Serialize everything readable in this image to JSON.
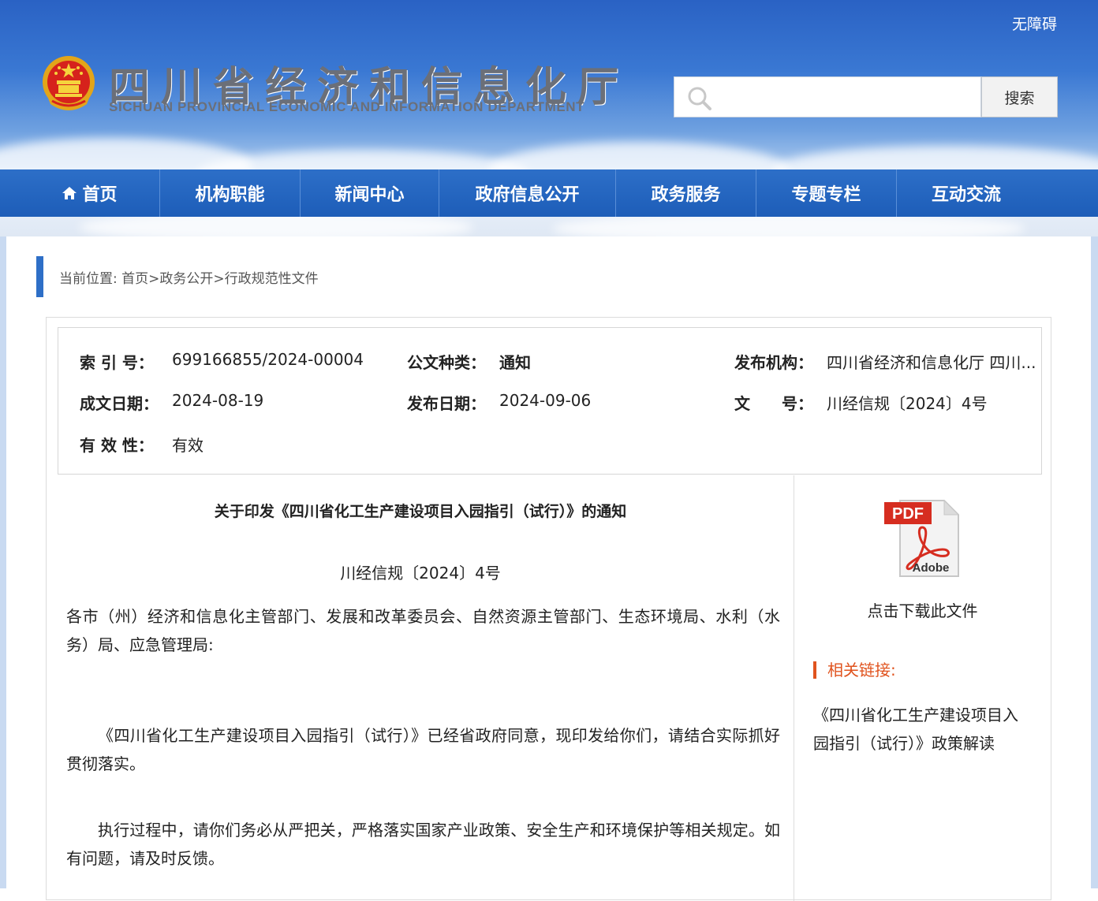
{
  "header": {
    "accessibility_label": "无障碍",
    "title_cn": "四川省经济和信息化厅",
    "title_en": "SICHUAN PROVINCIAL ECONOMIC AND INFORMATION DEPARTMENT",
    "search_placeholder": "",
    "search_button": "搜索"
  },
  "nav": {
    "items": [
      {
        "label": "首页",
        "icon": "home-icon"
      },
      {
        "label": "机构职能"
      },
      {
        "label": "新闻中心"
      },
      {
        "label": "政府信息公开"
      },
      {
        "label": "政务服务"
      },
      {
        "label": "专题专栏"
      },
      {
        "label": "互动交流"
      }
    ]
  },
  "breadcrumb": {
    "text": "当前位置: 首页>政务公开>行政规范性文件"
  },
  "meta": {
    "index_label": "索 引 号：",
    "index_value": "699166855/2024-00004",
    "type_label": "公文种类：",
    "type_value": "通知",
    "org_label": "发布机构：",
    "org_value": "四川省经济和信息化厅 四川...",
    "created_label": "成文日期：",
    "created_value": "2024-08-19",
    "published_label": "发布日期：",
    "published_value": "2024-09-06",
    "docno_label": "文　　号：",
    "docno_value": "川经信规〔2024〕4号",
    "validity_label": "有 效 性：",
    "validity_value": "有效"
  },
  "article": {
    "title": "关于印发《四川省化工生产建设项目入园指引（试行）》的通知",
    "doc_number": "川经信规〔2024〕4号",
    "addressee": "各市（州）经济和信息化主管部门、发展和改革委员会、自然资源主管部门、生态环境局、水利（水务）局、应急管理局:",
    "para1": "《四川省化工生产建设项目入园指引（试行）》已经省政府同意，现印发给你们，请结合实际抓好贯彻落实。",
    "para2": "执行过程中，请你们务必从严把关，严格落实国家产业政策、安全生产和环境保护等相关规定。如有问题，请及时反馈。"
  },
  "aside": {
    "pdf_badge": "PDF",
    "pdf_brand": "Adobe",
    "download_label": "点击下载此文件",
    "related_heading": "相关链接:",
    "related_link": "《四川省化工生产建设项目入园指引（试行）》政策解读"
  },
  "colors": {
    "nav_blue": "#1d5db8",
    "accent_blue": "#2e6fc7",
    "related_orange": "#e0531e"
  }
}
